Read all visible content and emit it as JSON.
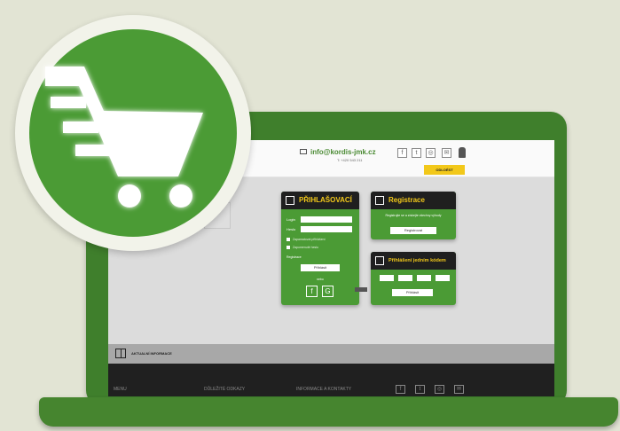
{
  "header": {
    "email": "info@kordis-jmk.cz",
    "phone": "T: +420 543 211 ",
    "login_button": "ODLOÉST"
  },
  "login_panel": {
    "title": "PŘIHLAŠOVACÍ",
    "field_login_label": "Login",
    "field_password_label": "Heslo",
    "remember_label": "Zapamatovat přihlášení",
    "forgot_label": "Zapomenuté heslo",
    "register_link": "Registrace",
    "submit_button": "Přihlásit",
    "social_label": "nebo"
  },
  "register_panel": {
    "title": "Registrace",
    "description": "Registrujte se a získejte všechny výhody",
    "button": "Registrovat"
  },
  "fast_panel": {
    "title": "Přihlášení jedním kódem",
    "inputs": [
      "",
      "",
      "",
      ""
    ],
    "button": "Přihlásit"
  },
  "strip": {
    "label": "AKTUALNÍ INFORMACE"
  },
  "footer": {
    "col1": "MENU",
    "col2": "DŮLEŽITÉ ODKAZY",
    "col3": "INFORMACE A KONTAKTY"
  },
  "icons": [
    "shopping-cart-icon",
    "mail-icon",
    "facebook-icon",
    "twitter-icon",
    "instagram-icon",
    "lock-icon",
    "book-icon"
  ],
  "colors": {
    "green": "#4b9b35",
    "dark_green": "#3f7f2c",
    "yellow": "#f2c81a",
    "dark": "#1f1f1f"
  }
}
